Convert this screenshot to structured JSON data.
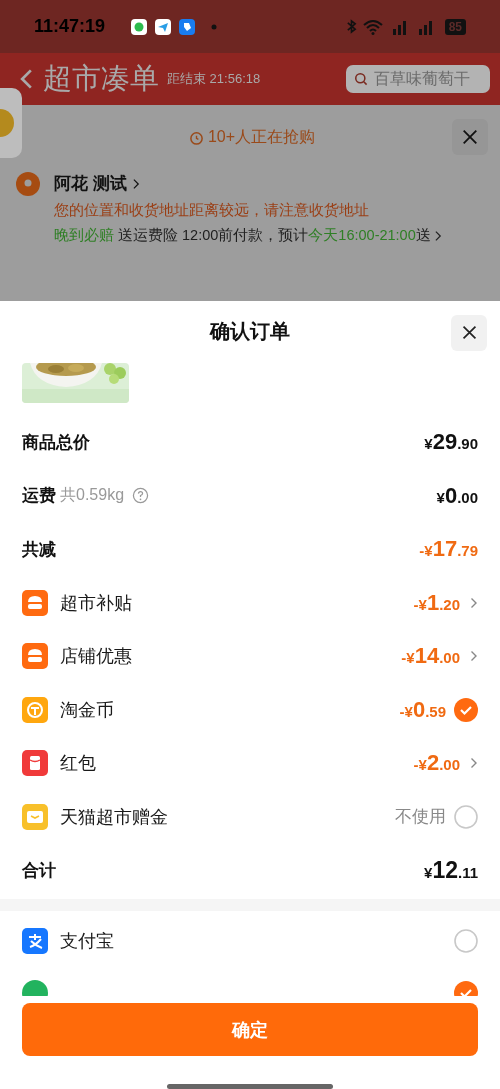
{
  "status_bar": {
    "time": "11:47:19",
    "battery": "85"
  },
  "header": {
    "title": "超市凑单",
    "countdown": "距结束 21:56:18",
    "search": {
      "placeholder": "百草味葡萄干"
    }
  },
  "promo_panel": {
    "banner": "10+人正在抢购",
    "address": {
      "name": "阿花 测试",
      "warning": "您的位置和收货地址距离较远，请注意收货地址",
      "delivery": [
        {
          "text": "晚到必赔",
          "highlight": true
        },
        {
          "text": " 送运费险  12:00前付款，预计",
          "highlight": false
        },
        {
          "text": "今天16:00-21:00",
          "highlight": true
        },
        {
          "text": "送",
          "highlight": false
        }
      ]
    }
  },
  "sheet": {
    "title": "确认订单",
    "summary": [
      {
        "label": "商品总价",
        "amount": "¥29.90",
        "highlight": false
      },
      {
        "label": "运费",
        "note": "共0.59kg",
        "amount": "¥0.00",
        "highlight": false
      },
      {
        "label": "共减",
        "amount": "-¥17.79",
        "highlight": true
      }
    ],
    "discounts": [
      {
        "label": "超市补贴",
        "color": "#ff6a10",
        "kind": "link",
        "amount": "-¥1.20"
      },
      {
        "label": "店铺优惠",
        "color": "#ff6a10",
        "kind": "link",
        "amount": "-¥14.00"
      },
      {
        "label": "淘金币",
        "color": "#ffa70f",
        "kind": "toggle",
        "amount": "-¥0.59",
        "checked": true
      },
      {
        "label": "红包",
        "color": "#f03a3a",
        "kind": "link",
        "amount": "-¥2.00"
      },
      {
        "label": "天猫超市赠金",
        "color": "#f8c02a",
        "kind": "toggle",
        "status": "不使用",
        "checked": false
      }
    ],
    "total": {
      "label": "合计",
      "amount": "¥12.11"
    },
    "payment_methods": [
      {
        "label": "支付宝",
        "color": "#1677ff",
        "selected": false
      },
      {
        "color": "#22b35e",
        "selected": true
      }
    ],
    "confirm_button": "确定"
  }
}
